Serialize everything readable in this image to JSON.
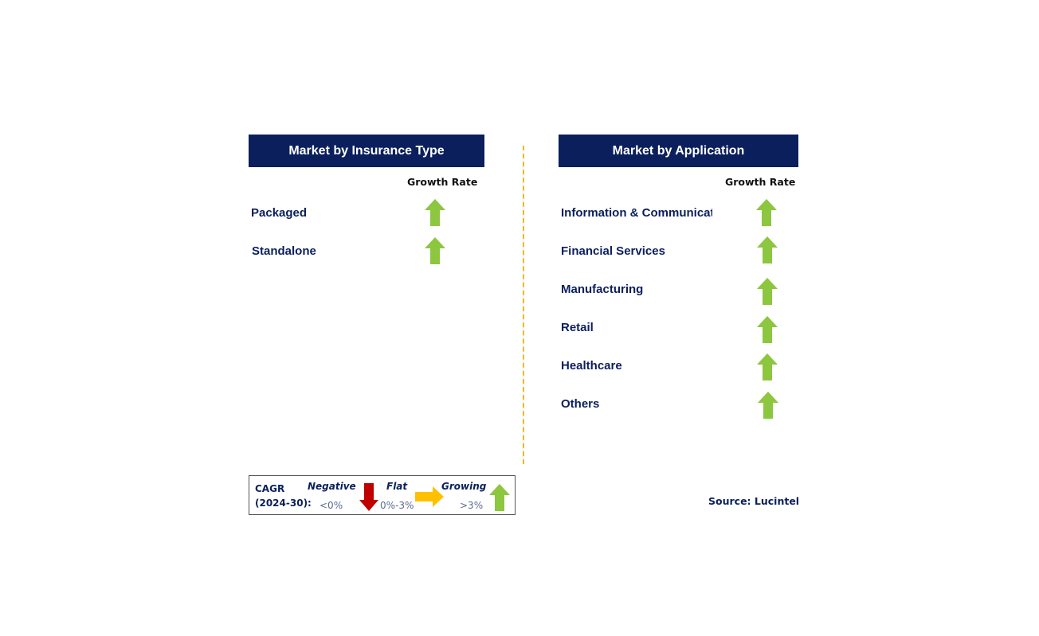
{
  "left_panel": {
    "title": "Market by Insurance Type",
    "growth_header": "Growth Rate",
    "rows": [
      {
        "label": "Packaged",
        "trend": "growing"
      },
      {
        "label": "Standalone",
        "trend": "growing"
      }
    ]
  },
  "right_panel": {
    "title": "Market by Application",
    "growth_header": "Growth Rate",
    "rows": [
      {
        "label": "Information & Communicati",
        "trend": "growing"
      },
      {
        "label": "Financial Services",
        "trend": "growing"
      },
      {
        "label": "Manufacturing",
        "trend": "growing"
      },
      {
        "label": "Retail",
        "trend": "growing"
      },
      {
        "label": "Healthcare",
        "trend": "growing"
      },
      {
        "label": "Others",
        "trend": "growing"
      }
    ]
  },
  "legend": {
    "cagr_line1": "CAGR",
    "cagr_line2": "(2024-30):",
    "negative_label": "Negative",
    "negative_range": "<0%",
    "flat_label": "Flat",
    "flat_range": "0%-3%",
    "growing_label": "Growing",
    "growing_range": ">3%"
  },
  "source": "Source: Lucintel",
  "colors": {
    "header_bg": "#0b1f5c",
    "growing_arrow": "#8dc63f",
    "negative_arrow": "#c00000",
    "flat_arrow": "#ffc000",
    "divider": "#f5b800"
  }
}
